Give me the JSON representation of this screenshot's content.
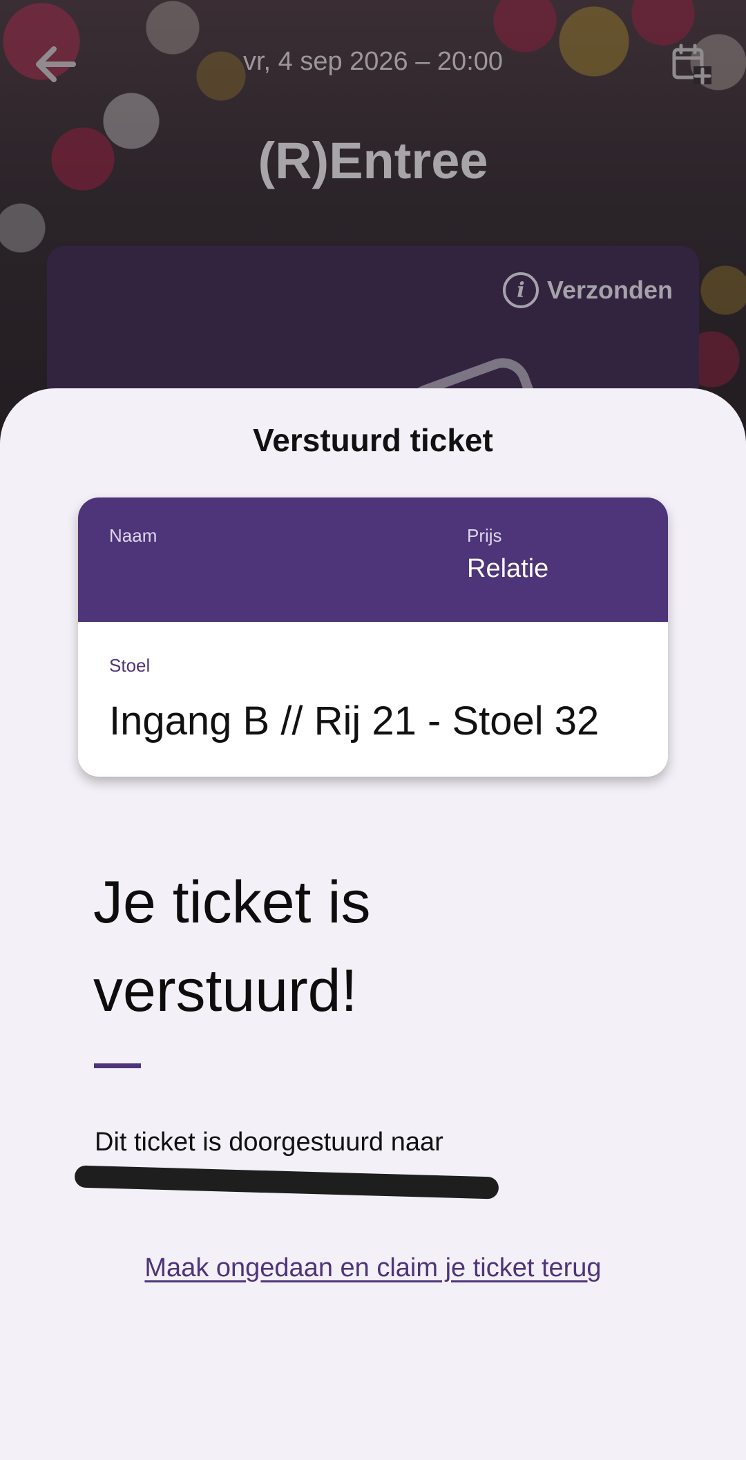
{
  "header": {
    "date": "vr, 4 sep 2026 – 20:00",
    "title": "(R)Entree",
    "status_label": "Verzonden",
    "icons": [
      "arrow-left-icon",
      "calendar-add-icon",
      "info-icon"
    ]
  },
  "sheet": {
    "title": "Verstuurd ticket",
    "card": {
      "name_label": "Naam",
      "name_value": "",
      "price_label": "Prijs",
      "price_value": "Relatie",
      "seat_label": "Stoel",
      "seat_value": "Ingang B // Rij 21 - Stoel 32"
    },
    "heading_line1": "Je ticket is",
    "heading_line2": "verstuurd!",
    "info_text": "Dit ticket is doorgestuurd naar",
    "undo_link": "Maak ongedaan en claim je ticket terug"
  },
  "colors": {
    "primary": "#4e3479",
    "sheet_background": "#f3f0f7",
    "card_header": "#4e3479"
  }
}
